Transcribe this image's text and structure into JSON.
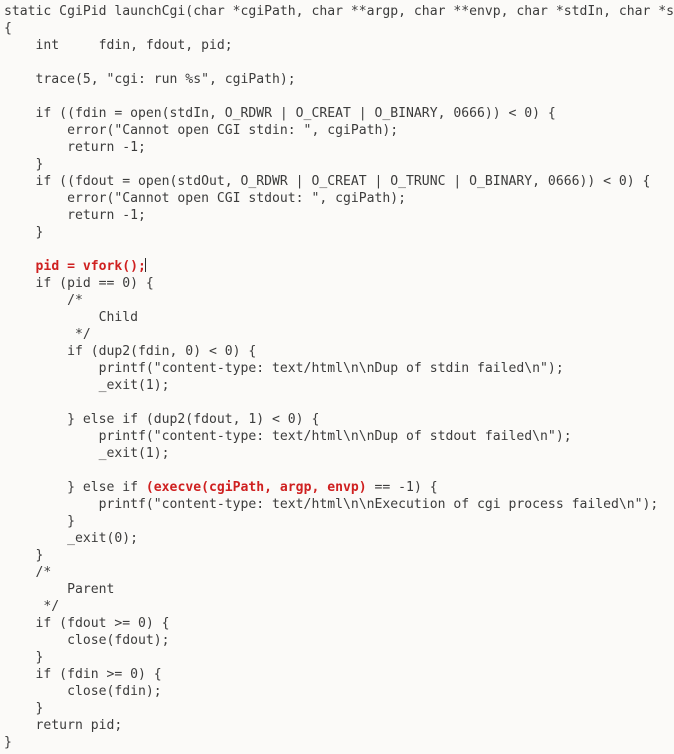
{
  "editor": {
    "background_color": "#fbfaf8",
    "text_color": "#3c3c3c",
    "highlight_color": "#cf2020",
    "caret_color": "#2b2b2b",
    "language": "c",
    "cursor_line_index": 14,
    "cursor_line_text": "    pid = vfork();"
  },
  "code": {
    "lines": [
      {
        "id": "l1",
        "segments": [
          {
            "style": "plain",
            "text": "static CgiPid launchCgi(char *cgiPath, char **argp, char **envp, char *stdIn, char *stdOut)"
          }
        ]
      },
      {
        "id": "l2",
        "segments": [
          {
            "style": "plain",
            "text": "{"
          }
        ]
      },
      {
        "id": "l3",
        "segments": [
          {
            "style": "plain",
            "text": "    int     fdin, fdout, pid;"
          }
        ]
      },
      {
        "id": "l4",
        "segments": [
          {
            "style": "plain",
            "text": ""
          }
        ]
      },
      {
        "id": "l5",
        "segments": [
          {
            "style": "plain",
            "text": "    trace(5, \"cgi: run %s\", cgiPath);"
          }
        ]
      },
      {
        "id": "l6",
        "segments": [
          {
            "style": "plain",
            "text": ""
          }
        ]
      },
      {
        "id": "l7",
        "segments": [
          {
            "style": "plain",
            "text": "    if ((fdin = open(stdIn, O_RDWR | O_CREAT | O_BINARY, 0666)) < 0) {"
          }
        ]
      },
      {
        "id": "l8",
        "segments": [
          {
            "style": "plain",
            "text": "        error(\"Cannot open CGI stdin: \", cgiPath);"
          }
        ]
      },
      {
        "id": "l9",
        "segments": [
          {
            "style": "plain",
            "text": "        return -1;"
          }
        ]
      },
      {
        "id": "l10",
        "segments": [
          {
            "style": "plain",
            "text": "    }"
          }
        ]
      },
      {
        "id": "l11",
        "segments": [
          {
            "style": "plain",
            "text": "    if ((fdout = open(stdOut, O_RDWR | O_CREAT | O_TRUNC | O_BINARY, 0666)) < 0) {"
          }
        ]
      },
      {
        "id": "l12",
        "segments": [
          {
            "style": "plain",
            "text": "        error(\"Cannot open CGI stdout: \", cgiPath);"
          }
        ]
      },
      {
        "id": "l13",
        "segments": [
          {
            "style": "plain",
            "text": "        return -1;"
          }
        ]
      },
      {
        "id": "l14",
        "segments": [
          {
            "style": "plain",
            "text": "    }"
          }
        ]
      },
      {
        "id": "l15",
        "segments": [
          {
            "style": "plain",
            "text": ""
          }
        ]
      },
      {
        "id": "l16",
        "caret_after": true,
        "segments": [
          {
            "style": "plain",
            "text": "    "
          },
          {
            "style": "highlight",
            "text": "pid = vfork();"
          }
        ]
      },
      {
        "id": "l17",
        "segments": [
          {
            "style": "plain",
            "text": "    if (pid == 0) {"
          }
        ]
      },
      {
        "id": "l18",
        "segments": [
          {
            "style": "plain",
            "text": "        /*"
          }
        ]
      },
      {
        "id": "l19",
        "segments": [
          {
            "style": "plain",
            "text": "            Child"
          }
        ]
      },
      {
        "id": "l20",
        "segments": [
          {
            "style": "plain",
            "text": "         */"
          }
        ]
      },
      {
        "id": "l21",
        "segments": [
          {
            "style": "plain",
            "text": "        if (dup2(fdin, 0) < 0) {"
          }
        ]
      },
      {
        "id": "l22",
        "segments": [
          {
            "style": "plain",
            "text": "            printf(\"content-type: text/html\\n\\nDup of stdin failed\\n\");"
          }
        ]
      },
      {
        "id": "l23",
        "segments": [
          {
            "style": "plain",
            "text": "            _exit(1);"
          }
        ]
      },
      {
        "id": "l24",
        "segments": [
          {
            "style": "plain",
            "text": ""
          }
        ]
      },
      {
        "id": "l25",
        "segments": [
          {
            "style": "plain",
            "text": "        } else if (dup2(fdout, 1) < 0) {"
          }
        ]
      },
      {
        "id": "l26",
        "segments": [
          {
            "style": "plain",
            "text": "            printf(\"content-type: text/html\\n\\nDup of stdout failed\\n\");"
          }
        ]
      },
      {
        "id": "l27",
        "segments": [
          {
            "style": "plain",
            "text": "            _exit(1);"
          }
        ]
      },
      {
        "id": "l28",
        "segments": [
          {
            "style": "plain",
            "text": ""
          }
        ]
      },
      {
        "id": "l29",
        "segments": [
          {
            "style": "plain",
            "text": "        } else if "
          },
          {
            "style": "highlight",
            "text": "(execve(cgiPath, argp, envp)"
          },
          {
            "style": "plain",
            "text": " == -1) {"
          }
        ]
      },
      {
        "id": "l30",
        "segments": [
          {
            "style": "plain",
            "text": "            printf(\"content-type: text/html\\n\\nExecution of cgi process failed\\n\");"
          }
        ]
      },
      {
        "id": "l31",
        "segments": [
          {
            "style": "plain",
            "text": "        }"
          }
        ]
      },
      {
        "id": "l32",
        "segments": [
          {
            "style": "plain",
            "text": "        _exit(0);"
          }
        ]
      },
      {
        "id": "l33",
        "segments": [
          {
            "style": "plain",
            "text": "    }"
          }
        ]
      },
      {
        "id": "l34",
        "segments": [
          {
            "style": "plain",
            "text": "    /*"
          }
        ]
      },
      {
        "id": "l35",
        "segments": [
          {
            "style": "plain",
            "text": "        Parent"
          }
        ]
      },
      {
        "id": "l36",
        "segments": [
          {
            "style": "plain",
            "text": "     */"
          }
        ]
      },
      {
        "id": "l37",
        "segments": [
          {
            "style": "plain",
            "text": "    if (fdout >= 0) {"
          }
        ]
      },
      {
        "id": "l38",
        "segments": [
          {
            "style": "plain",
            "text": "        close(fdout);"
          }
        ]
      },
      {
        "id": "l39",
        "segments": [
          {
            "style": "plain",
            "text": "    }"
          }
        ]
      },
      {
        "id": "l40",
        "segments": [
          {
            "style": "plain",
            "text": "    if (fdin >= 0) {"
          }
        ]
      },
      {
        "id": "l41",
        "segments": [
          {
            "style": "plain",
            "text": "        close(fdin);"
          }
        ]
      },
      {
        "id": "l42",
        "segments": [
          {
            "style": "plain",
            "text": "    }"
          }
        ]
      },
      {
        "id": "l43",
        "segments": [
          {
            "style": "plain",
            "text": "    return pid;"
          }
        ]
      },
      {
        "id": "l44",
        "segments": [
          {
            "style": "plain",
            "text": "}"
          }
        ]
      }
    ]
  }
}
